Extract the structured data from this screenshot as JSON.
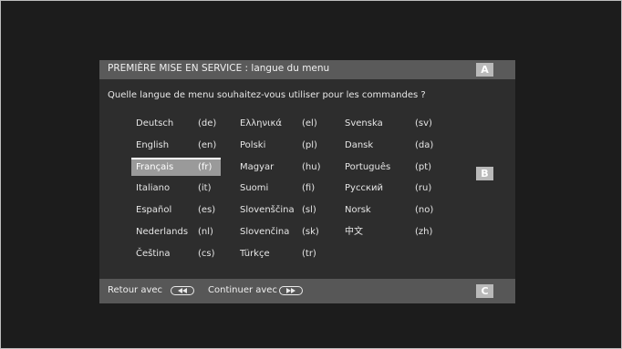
{
  "header": {
    "title": "PREMIÈRE MISE EN SERVICE : langue du menu",
    "badge_a": "A",
    "badge_b": "B",
    "badge_c": "C"
  },
  "question": "Quelle langue de menu souhaitez-vous utiliser pour les commandes ?",
  "languages": [
    {
      "name": "Deutsch",
      "code": "(de)"
    },
    {
      "name": "English",
      "code": "(en)"
    },
    {
      "name": "Français",
      "code": "(fr)",
      "selected": true
    },
    {
      "name": "Italiano",
      "code": "(it)"
    },
    {
      "name": "Español",
      "code": "(es)"
    },
    {
      "name": "Nederlands",
      "code": "(nl)"
    },
    {
      "name": "Čeština",
      "code": "(cs)"
    },
    {
      "name": "Ελληνικά",
      "code": "(el)"
    },
    {
      "name": "Polski",
      "code": "(pl)"
    },
    {
      "name": "Magyar",
      "code": "(hu)"
    },
    {
      "name": "Suomi",
      "code": "(fi)"
    },
    {
      "name": "Slovenščina",
      "code": "(sl)"
    },
    {
      "name": "Slovenčina",
      "code": "(sk)"
    },
    {
      "name": "Türkçe",
      "code": "(tr)"
    },
    {
      "name": "Svenska",
      "code": "(sv)"
    },
    {
      "name": "Dansk",
      "code": "(da)"
    },
    {
      "name": "Português",
      "code": "(pt)"
    },
    {
      "name": "Русский",
      "code": "(ru)"
    },
    {
      "name": "Norsk",
      "code": "(no)"
    },
    {
      "name": "中文",
      "code": "(zh)"
    }
  ],
  "footer": {
    "back_label": "Retour avec",
    "back_icon": "rewind-icon",
    "continue_label": "Continuer avec",
    "continue_icon": "fast-forward-icon"
  },
  "colors": {
    "background": "#1c1c1c",
    "dialog": "#2d2d2d",
    "titlebar": "#5a5a5a",
    "selection": "#9a9a9a",
    "badge": "#b9b9b9"
  }
}
